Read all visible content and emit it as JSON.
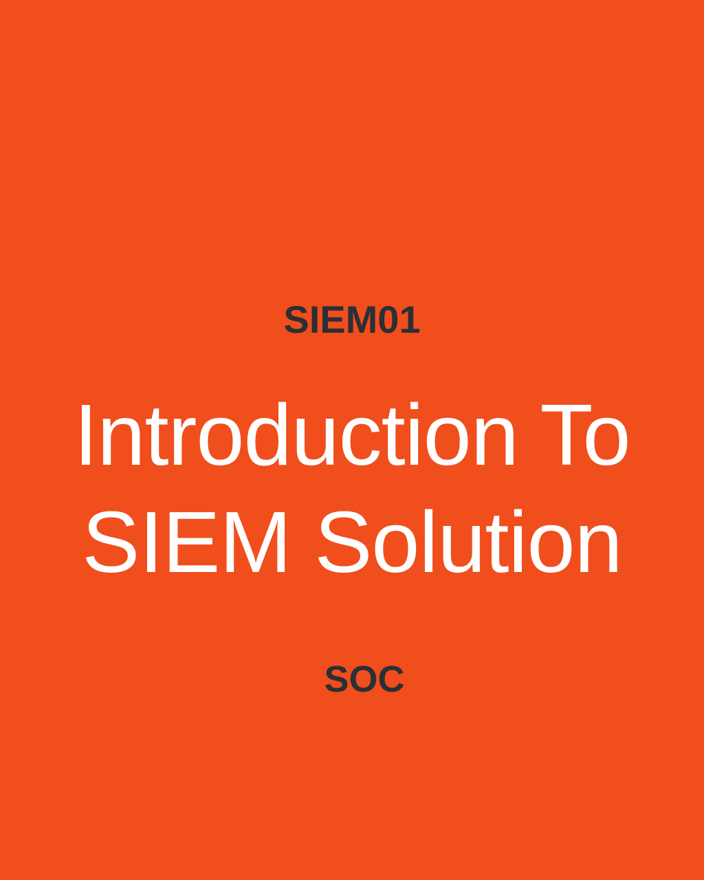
{
  "colors": {
    "background": "#F04E1C",
    "title": "#FFFFFF",
    "subtext": "#2B2F36"
  },
  "course_code": "SIEM01",
  "title": {
    "line1": "Introduction To",
    "line2": "SIEM Solution"
  },
  "category": "SOC"
}
